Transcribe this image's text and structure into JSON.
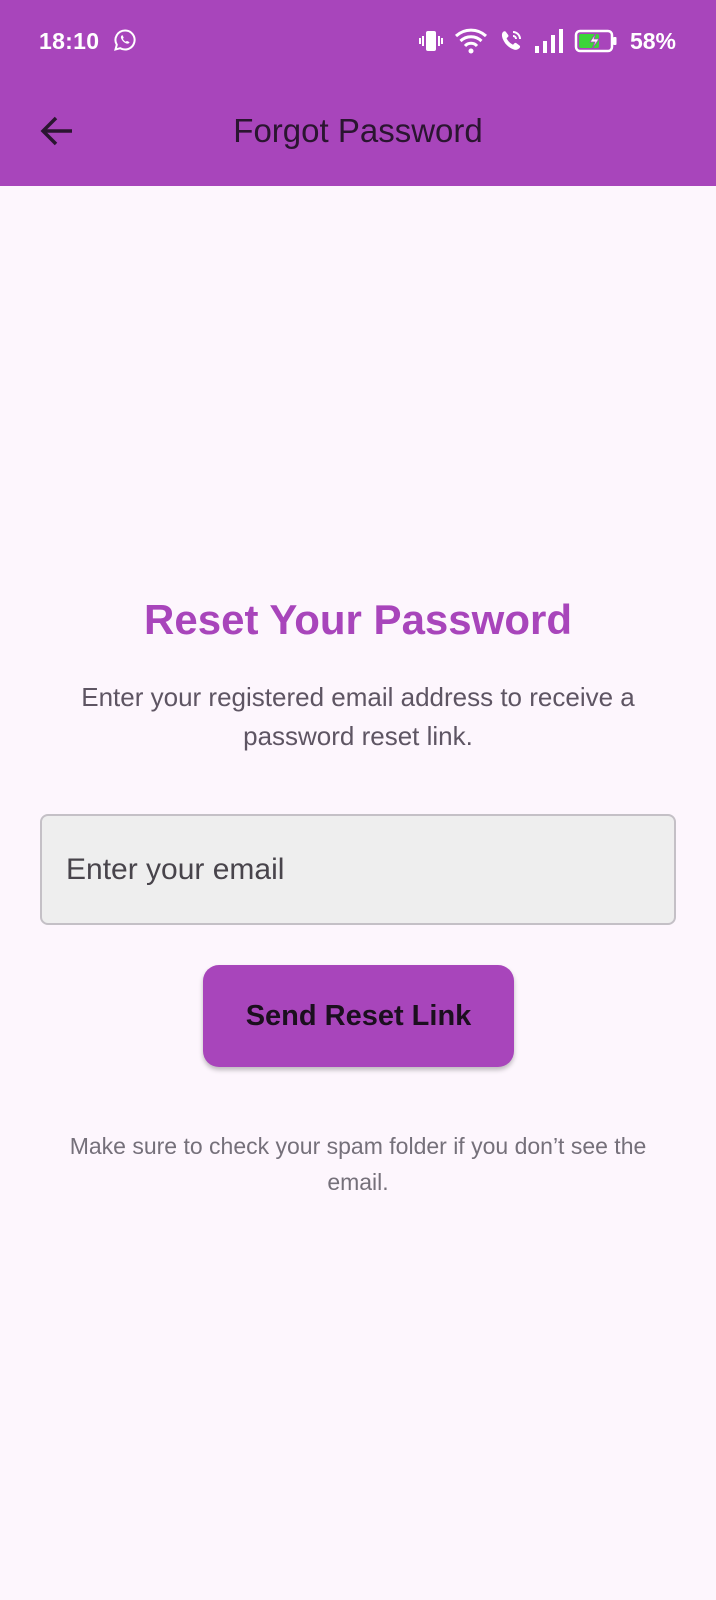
{
  "status_bar": {
    "time": "18:10",
    "battery_percent": "58%",
    "icons": [
      "whatsapp-icon",
      "vibrate-icon",
      "wifi-icon",
      "wifi-calling-icon",
      "signal-icon",
      "battery-charging-icon"
    ]
  },
  "app_bar": {
    "title": "Forgot Password",
    "back_icon": "arrow-left-icon"
  },
  "main": {
    "heading": "Reset Your Password",
    "subtext": "Enter your registered email address to receive a password reset link.",
    "email_field": {
      "placeholder": "Enter your email",
      "value": ""
    },
    "send_button_label": "Send Reset Link",
    "note": "Make sure to check your spam folder if you don’t see the email."
  },
  "colors": {
    "primary": "#a845bb",
    "background": "#fdf6fd",
    "field_background": "#eeeeee"
  }
}
